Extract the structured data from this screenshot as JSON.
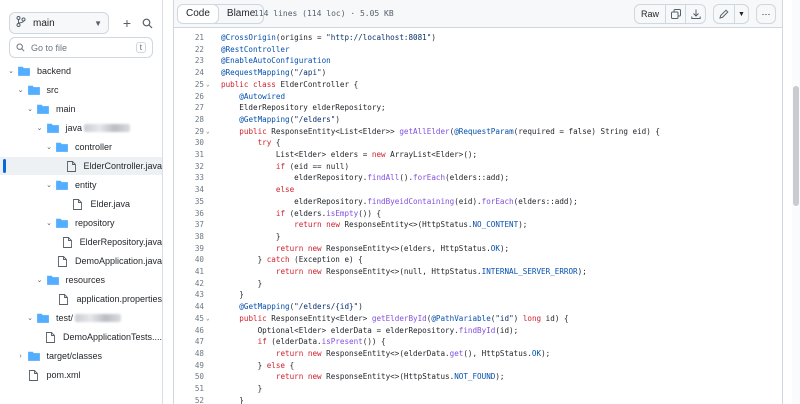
{
  "sidebar": {
    "branch": "main",
    "goto_placeholder": "Go to file",
    "goto_shortcut": "t",
    "tree": [
      {
        "label": "backend",
        "type": "folder",
        "depth": 0,
        "expanded": true
      },
      {
        "label": "src",
        "type": "folder",
        "depth": 1,
        "expanded": true
      },
      {
        "label": "main",
        "type": "folder",
        "depth": 2,
        "expanded": true
      },
      {
        "label": "java",
        "type": "folder",
        "depth": 3,
        "expanded": true,
        "redacted": true
      },
      {
        "label": "controller",
        "type": "folder",
        "depth": 4,
        "expanded": true
      },
      {
        "label": "ElderController.java",
        "type": "file",
        "depth": 5,
        "active": true
      },
      {
        "label": "entity",
        "type": "folder",
        "depth": 4,
        "expanded": true
      },
      {
        "label": "Elder.java",
        "type": "file",
        "depth": 5
      },
      {
        "label": "repository",
        "type": "folder",
        "depth": 4,
        "expanded": true
      },
      {
        "label": "ElderRepository.java",
        "type": "file",
        "depth": 5
      },
      {
        "label": "DemoApplication.java",
        "type": "file",
        "depth": 4
      },
      {
        "label": "resources",
        "type": "folder",
        "depth": 3,
        "expanded": true
      },
      {
        "label": "application.properties",
        "type": "file",
        "depth": 4
      },
      {
        "label": "test/",
        "type": "folder",
        "depth": 2,
        "expanded": true,
        "redacted": true
      },
      {
        "label": "DemoApplicationTests....",
        "type": "file",
        "depth": 3
      },
      {
        "label": "target/classes",
        "type": "folder",
        "depth": 1,
        "expanded": false
      },
      {
        "label": "pom.xml",
        "type": "file",
        "depth": 1
      }
    ]
  },
  "viewer": {
    "tab_code": "Code",
    "tab_blame": "Blame",
    "meta": "114 lines (114 loc) · 5.05 KB",
    "raw_label": "Raw",
    "lines": [
      {
        "n": "21",
        "t": "@CrossOrigin(origins = \"http://localhost:8081\")"
      },
      {
        "n": "22",
        "t": "@RestController"
      },
      {
        "n": "23",
        "t": "@EnableAutoConfiguration"
      },
      {
        "n": "24",
        "t": "@RequestMapping(\"/api\")"
      },
      {
        "n": "25",
        "t": "public class ElderController {",
        "fold": true
      },
      {
        "n": "26",
        "t": "    @Autowired"
      },
      {
        "n": "27",
        "t": "    ElderRepository elderRepository;"
      },
      {
        "n": "28",
        "t": "    @GetMapping(\"/elders\")"
      },
      {
        "n": "29",
        "t": "    public ResponseEntity<List<Elder>> getAllElder(@RequestParam(required = false) String eid) {",
        "fold": true
      },
      {
        "n": "30",
        "t": "        try {"
      },
      {
        "n": "31",
        "t": "            List<Elder> elders = new ArrayList<Elder>();"
      },
      {
        "n": "32",
        "t": "            if (eid == null)"
      },
      {
        "n": "33",
        "t": "                elderRepository.findAll().forEach(elders::add);"
      },
      {
        "n": "34",
        "t": "            else"
      },
      {
        "n": "35",
        "t": "                elderRepository.findByeidContaining(eid).forEach(elders::add);"
      },
      {
        "n": "36",
        "t": "            if (elders.isEmpty()) {"
      },
      {
        "n": "37",
        "t": "                return new ResponseEntity<>(HttpStatus.NO_CONTENT);"
      },
      {
        "n": "38",
        "t": "            }"
      },
      {
        "n": "39",
        "t": "            return new ResponseEntity<>(elders, HttpStatus.OK);"
      },
      {
        "n": "40",
        "t": "        } catch (Exception e) {"
      },
      {
        "n": "41",
        "t": "            return new ResponseEntity<>(null, HttpStatus.INTERNAL_SERVER_ERROR);"
      },
      {
        "n": "42",
        "t": "        }"
      },
      {
        "n": "43",
        "t": "    }"
      },
      {
        "n": "44",
        "t": "    @GetMapping(\"/elders/{id}\")"
      },
      {
        "n": "45",
        "t": "    public ResponseEntity<Elder> getElderById(@PathVariable(\"id\") long id) {",
        "fold": true
      },
      {
        "n": "46",
        "t": "        Optional<Elder> elderData = elderRepository.findById(id);"
      },
      {
        "n": "47",
        "t": "        if (elderData.isPresent()) {"
      },
      {
        "n": "48",
        "t": "            return new ResponseEntity<>(elderData.get(), HttpStatus.OK);"
      },
      {
        "n": "49",
        "t": "        } else {"
      },
      {
        "n": "50",
        "t": "            return new ResponseEntity<>(HttpStatus.NOT_FOUND);"
      },
      {
        "n": "51",
        "t": "        }"
      },
      {
        "n": "52",
        "t": "    }"
      }
    ]
  },
  "colors": {
    "accent": "#0969da",
    "keyword": "#cf222e",
    "annotation": "#0550ae",
    "string": "#0a3069",
    "function": "#8250df"
  }
}
